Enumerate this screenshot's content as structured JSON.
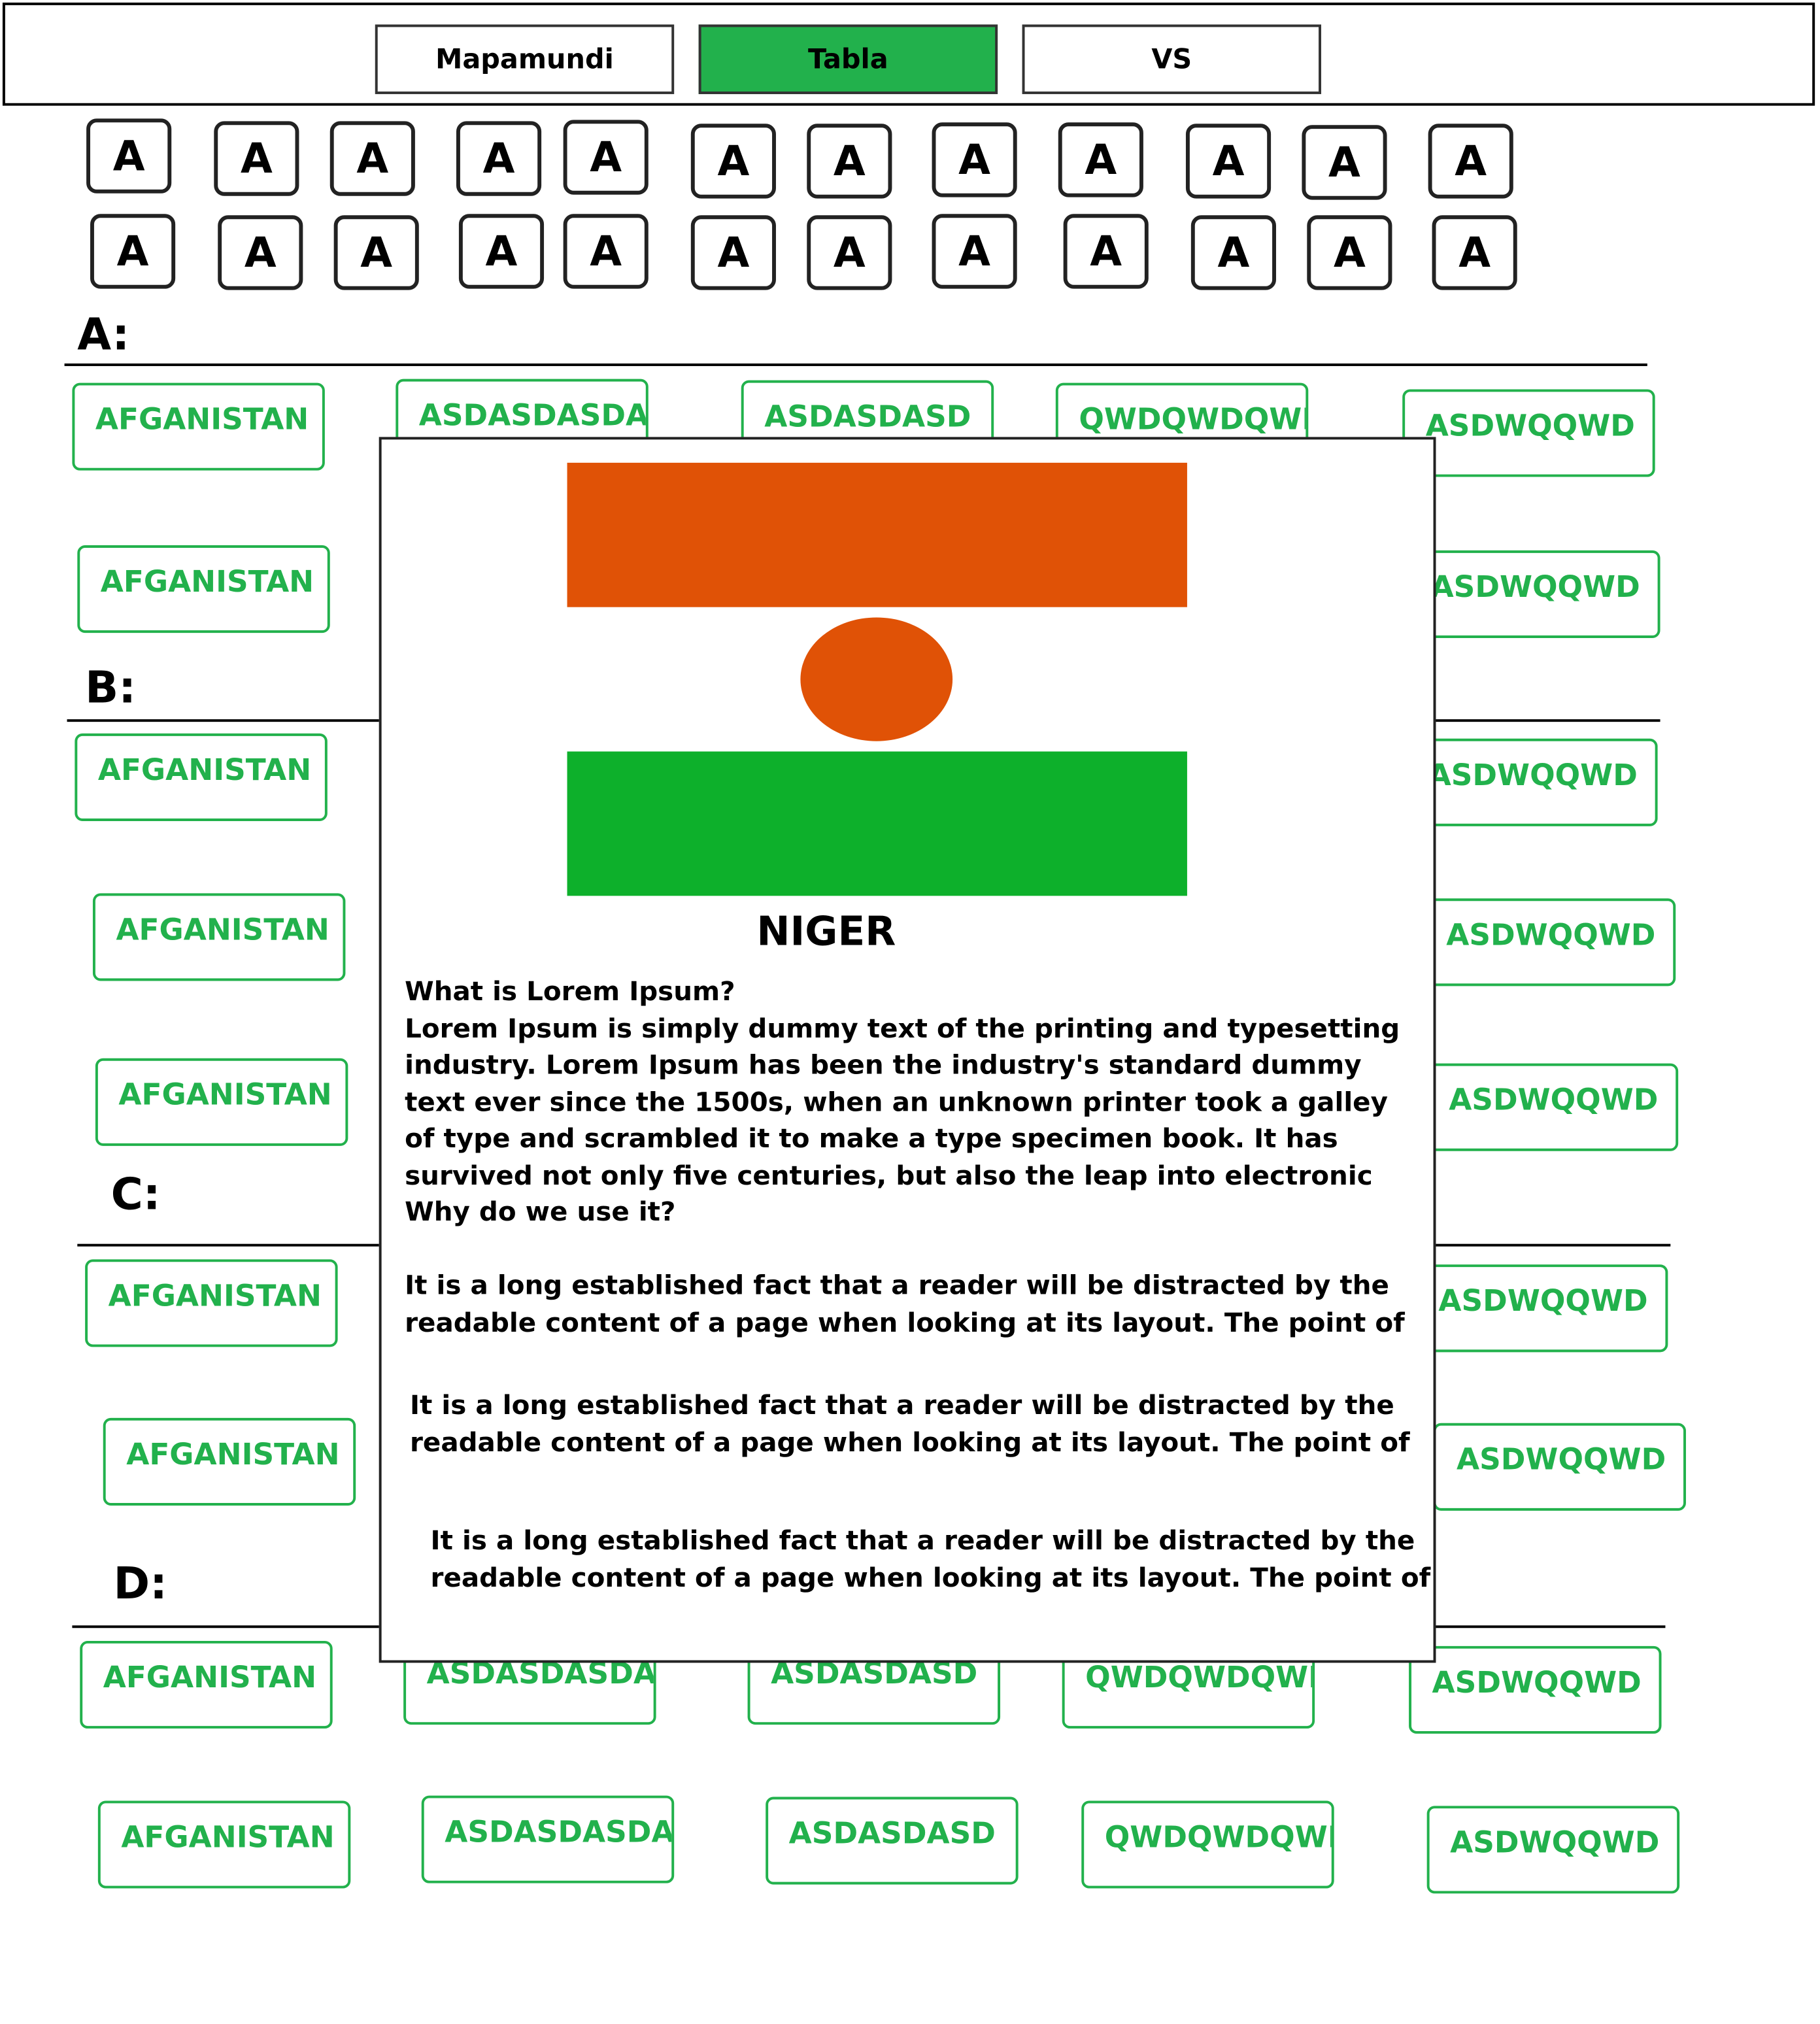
{
  "nav": {
    "tabs": [
      {
        "label": "Mapamundi",
        "active": false
      },
      {
        "label": "Tabla",
        "active": true
      },
      {
        "label": "VS",
        "active": false
      }
    ],
    "active_color": "#22b14c"
  },
  "letters": {
    "row1": [
      "A",
      "A",
      "A",
      "A",
      "A",
      "A",
      "A",
      "A",
      "A",
      "A",
      "A",
      "A"
    ],
    "row2": [
      "A",
      "A",
      "A",
      "A",
      "A",
      "A",
      "A",
      "A",
      "A",
      "A",
      "A",
      "A"
    ]
  },
  "sections": [
    {
      "label": "A:",
      "rows": [
        [
          "AFGANISTAN",
          "ASDASDASDA",
          "ASDASDASD",
          "QWDQWDQWD",
          "ASDWQQWD"
        ],
        [
          "AFGANISTAN",
          "ASDWQQWD"
        ]
      ]
    },
    {
      "label": "B:",
      "rows": [
        [
          "AFGANISTAN",
          "ASDWQQWD"
        ],
        [
          "AFGANISTAN",
          "ASDWQQWD"
        ],
        [
          "AFGANISTAN",
          "ASDWQQWD"
        ]
      ]
    },
    {
      "label": "C:",
      "rows": [
        [
          "AFGANISTAN",
          "ASDWQQWD"
        ],
        [
          "AFGANISTAN",
          "ASDWQQWD"
        ]
      ]
    },
    {
      "label": "D:",
      "rows": [
        [
          "AFGANISTAN",
          "ASDASDASDA",
          "ASDASDASD",
          "QWDQWDQWD",
          "ASDWQQWD"
        ],
        [
          "AFGANISTAN",
          "ASDASDASDA",
          "ASDASDASD",
          "QWDQWDQWD",
          "ASDWQQWD"
        ]
      ]
    }
  ],
  "country_color": "#22b14c",
  "modal": {
    "country": "NIGER",
    "flag_colors": {
      "top": "#e05206",
      "middle": "#ffffff",
      "bottom": "#0db02b",
      "circle": "#e05206"
    },
    "heading": "What is Lorem Ipsum?",
    "lines": [
      "Lorem Ipsum is simply dummy text of the printing and typesetting",
      "industry. Lorem Ipsum has been the industry's standard dummy",
      "text ever since the 1500s, when an unknown printer took a galley",
      "of type and scrambled it to make a type specimen book. It has",
      "survived not only five centuries, but also the leap into electronic",
      "Why do we use it?"
    ],
    "paragraphs": [
      [
        "It is a long established fact that a reader will be distracted by the",
        "readable content of a page when looking at its layout. The point of"
      ],
      [
        "It is a long established fact that a reader will be distracted by the",
        "readable content of a page when looking at its layout. The point of"
      ],
      [
        "It is a long established fact that a reader will be distracted by the",
        "readable content of a page when looking at its layout. The point of"
      ]
    ]
  }
}
